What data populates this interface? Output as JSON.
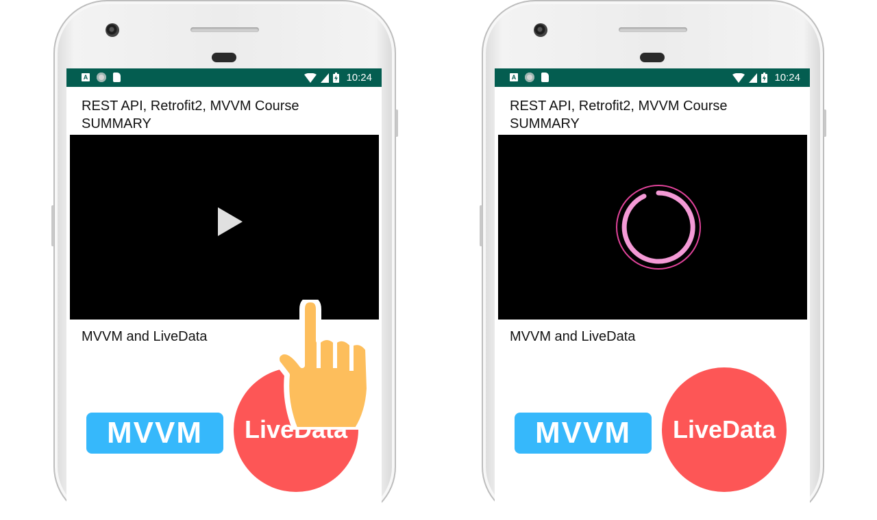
{
  "phones": [
    {
      "status": {
        "time": "10:24"
      },
      "title": "REST API, Retrofit2, MVVM Course SUMMARY",
      "video_title": "MVVM and LiveData",
      "badges": {
        "mvvm": "MVVM",
        "livedata": "LiveData"
      },
      "player_state": "paused",
      "icons": [
        "android-a-icon",
        "circle-notification-icon",
        "sd-card-icon",
        "wifi-icon",
        "cell-signal-icon",
        "battery-charging-icon",
        "play-icon",
        "hand-pointer-icon"
      ]
    },
    {
      "status": {
        "time": "10:24"
      },
      "title": "REST API, Retrofit2, MVVM Course SUMMARY",
      "video_title": "MVVM and LiveData",
      "badges": {
        "mvvm": "MVVM",
        "livedata": "LiveData"
      },
      "player_state": "loading",
      "icons": [
        "android-a-icon",
        "circle-notification-icon",
        "sd-card-icon",
        "wifi-icon",
        "cell-signal-icon",
        "battery-charging-icon",
        "loading-spinner-icon"
      ]
    }
  ],
  "colors": {
    "status_bar": "#045d50",
    "mvvm_badge": "#36b8fb",
    "livedata_badge": "#fd5656",
    "spinner": "#f49ad6",
    "hand": "#fdbe5c"
  }
}
